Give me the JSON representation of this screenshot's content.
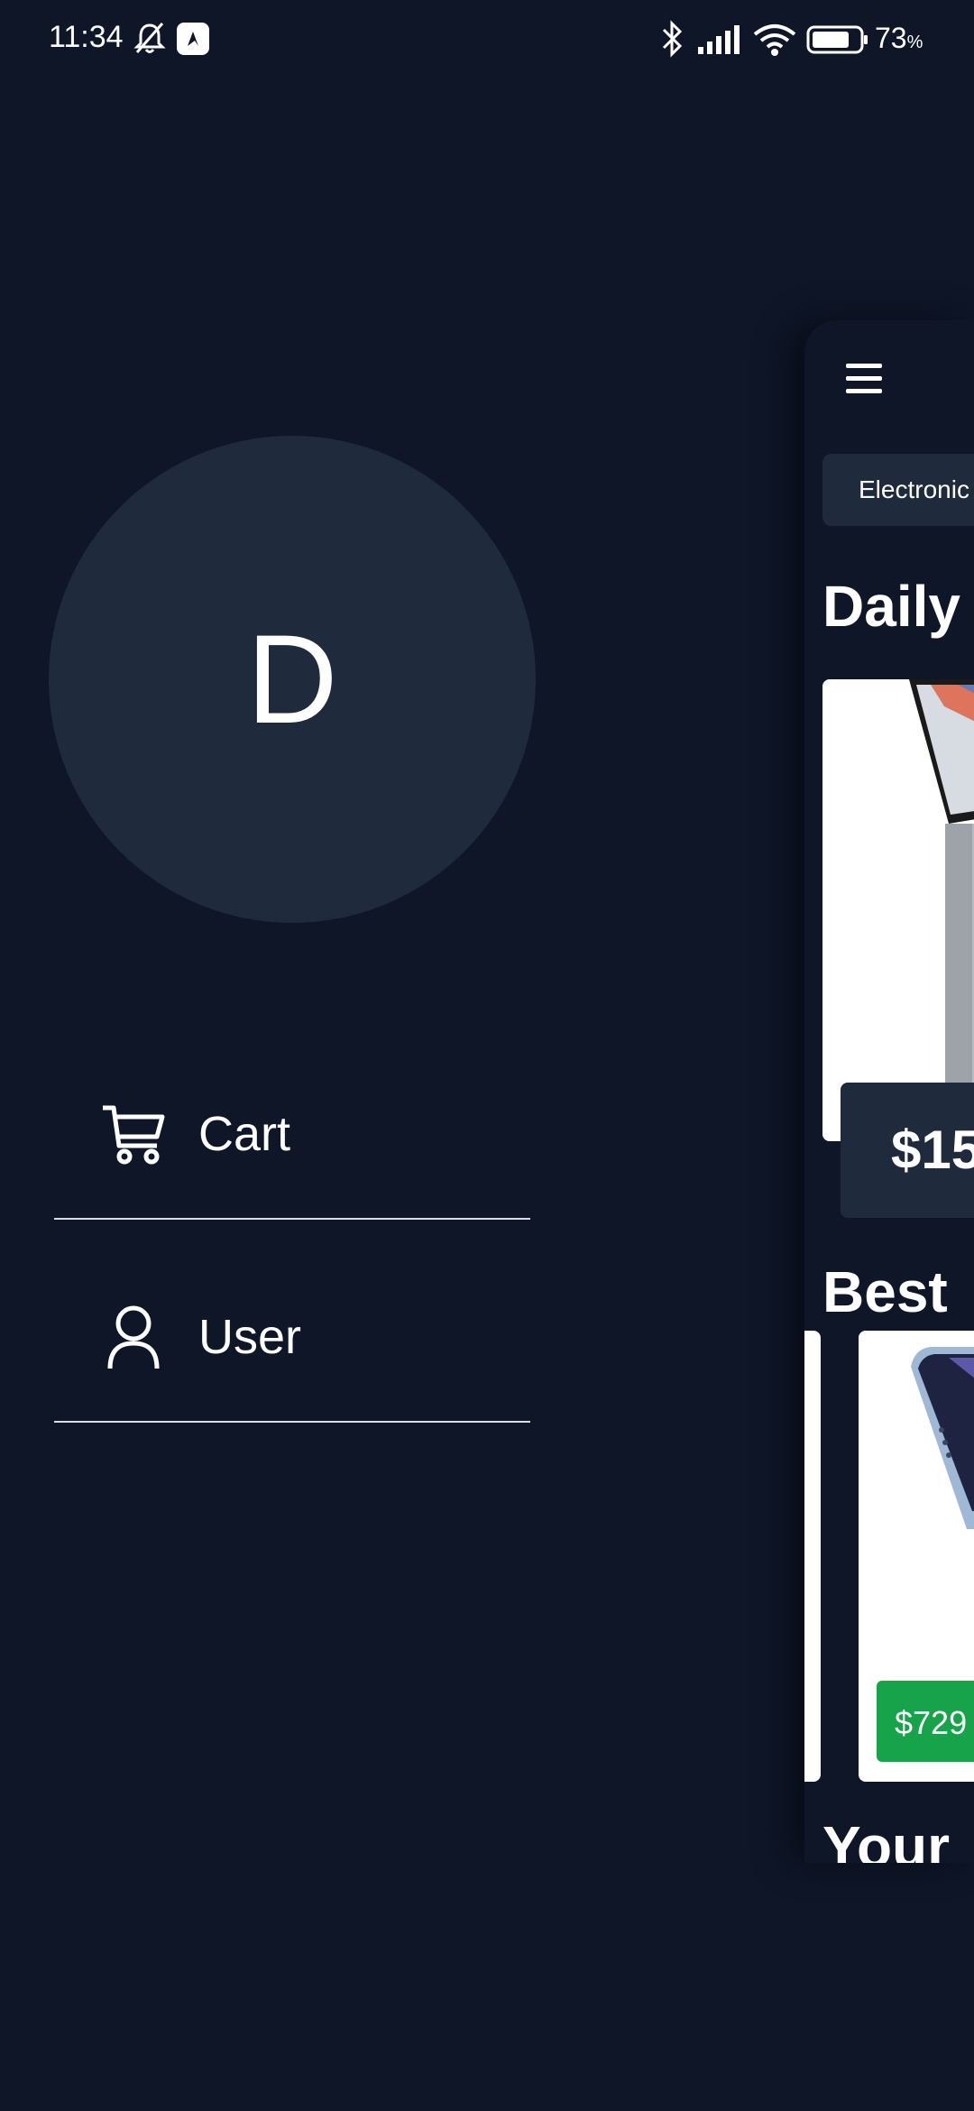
{
  "status_bar": {
    "time": "11:34",
    "battery_value": "73",
    "battery_unit": "%",
    "icons": [
      "bell-off-icon",
      "app-notification-icon",
      "bluetooth-icon",
      "signal-icon",
      "wifi-icon",
      "battery-icon"
    ]
  },
  "drawer": {
    "avatar_letter": "D",
    "items": [
      {
        "label": "Cart",
        "icon": "cart-icon"
      },
      {
        "label": "User",
        "icon": "user-icon"
      }
    ]
  },
  "main": {
    "menu_icon": "hamburger-menu-icon",
    "category_chip": "Electronic",
    "daily_title": "Daily",
    "daily_price": "$15",
    "best_title": "Best",
    "best_price": "$729",
    "your_title": "Your"
  },
  "colors": {
    "background": "#0e1628",
    "card_dark": "#1f2a3c",
    "price_badge": "#16a34a",
    "text": "#ffffff"
  }
}
